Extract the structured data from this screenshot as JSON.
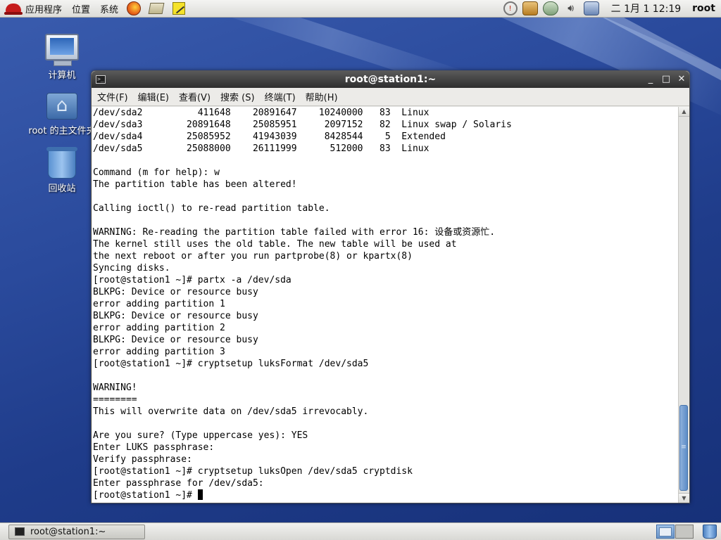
{
  "top_panel": {
    "menus": [
      "应用程序",
      "位置",
      "系统"
    ],
    "clock": "二 1月  1 12:19",
    "user": "root"
  },
  "desktop": {
    "icons": [
      {
        "label": "计算机"
      },
      {
        "label": "root 的主文件夹"
      },
      {
        "label": "回收站"
      }
    ]
  },
  "window": {
    "title": "root@station1:~",
    "buttons": {
      "minimize": "_",
      "maximize": "□",
      "close": "✕"
    },
    "menus": [
      "文件(F)",
      "编辑(E)",
      "查看(V)",
      "搜索 (S)",
      "终端(T)",
      "帮助(H)"
    ]
  },
  "terminal": {
    "lines": [
      "/dev/sda2          411648    20891647    10240000   83  Linux",
      "/dev/sda3        20891648    25085951     2097152   82  Linux swap / Solaris",
      "/dev/sda4        25085952    41943039     8428544    5  Extended",
      "/dev/sda5        25088000    26111999      512000   83  Linux",
      "",
      "Command (m for help): w",
      "The partition table has been altered!",
      "",
      "Calling ioctl() to re-read partition table.",
      "",
      "WARNING: Re-reading the partition table failed with error 16: 设备或资源忙.",
      "The kernel still uses the old table. The new table will be used at",
      "the next reboot or after you run partprobe(8) or kpartx(8)",
      "Syncing disks.",
      "[root@station1 ~]# partx -a /dev/sda",
      "BLKPG: Device or resource busy",
      "error adding partition 1",
      "BLKPG: Device or resource busy",
      "error adding partition 2",
      "BLKPG: Device or resource busy",
      "error adding partition 3",
      "[root@station1 ~]# cryptsetup luksFormat /dev/sda5",
      "",
      "WARNING!",
      "========",
      "This will overwrite data on /dev/sda5 irrevocably.",
      "",
      "Are you sure? (Type uppercase yes): YES",
      "Enter LUKS passphrase: ",
      "Verify passphrase: ",
      "[root@station1 ~]# cryptsetup luksOpen /dev/sda5 cryptdisk",
      "Enter passphrase for /dev/sda5: "
    ],
    "prompt": "[root@station1 ~]# "
  },
  "bottom_panel": {
    "task_label": "root@station1:~"
  }
}
